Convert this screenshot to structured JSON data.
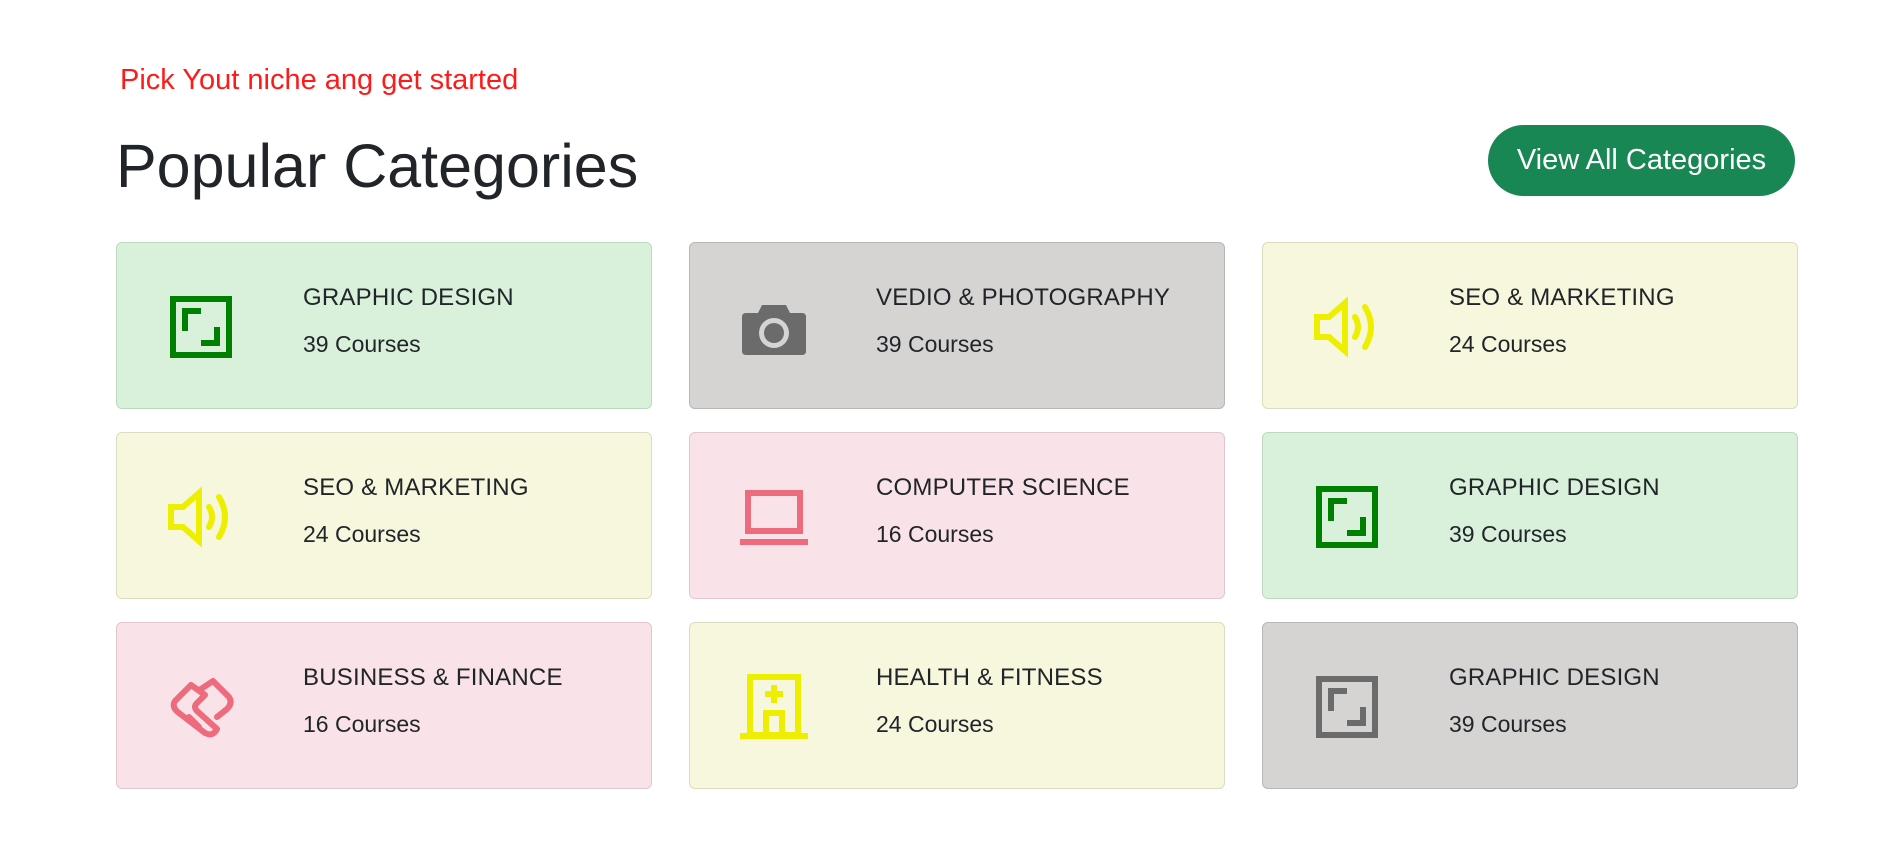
{
  "header": {
    "tagline": "Pick Yout niche ang get started",
    "title": "Popular Categories",
    "view_all_label": "View All Categories"
  },
  "colors": {
    "tagline": "#ff1a1a",
    "button": "#198754",
    "green_icon": "#008000",
    "gray_icon": "#6c6b6b",
    "yellow_icon": "#eeee00",
    "pink_icon": "#ee6a7d"
  },
  "categories": [
    {
      "name": "GRAPHIC DESIGN",
      "count": "39 Courses",
      "icon": "frame-icon",
      "theme": "green"
    },
    {
      "name": "VEDIO & PHOTOGRAPHY",
      "count": "39 Courses",
      "icon": "camera-icon",
      "theme": "gray"
    },
    {
      "name": "SEO & MARKETING",
      "count": "24 Courses",
      "icon": "speaker-icon",
      "theme": "yellow"
    },
    {
      "name": "SEO & MARKETING",
      "count": "24 Courses",
      "icon": "speaker-icon",
      "theme": "yellow"
    },
    {
      "name": "COMPUTER SCIENCE",
      "count": "16 Courses",
      "icon": "laptop-icon",
      "theme": "pink"
    },
    {
      "name": "GRAPHIC DESIGN",
      "count": "39 Courses",
      "icon": "frame-icon",
      "theme": "green"
    },
    {
      "name": "BUSINESS & FINANCE",
      "count": "16 Courses",
      "icon": "handshake-icon",
      "theme": "pink"
    },
    {
      "name": "HEALTH & FITNESS",
      "count": "24 Courses",
      "icon": "hospital-icon",
      "theme": "yellow"
    },
    {
      "name": "GRAPHIC DESIGN",
      "count": "39 Courses",
      "icon": "frame-icon",
      "theme": "gray"
    }
  ]
}
